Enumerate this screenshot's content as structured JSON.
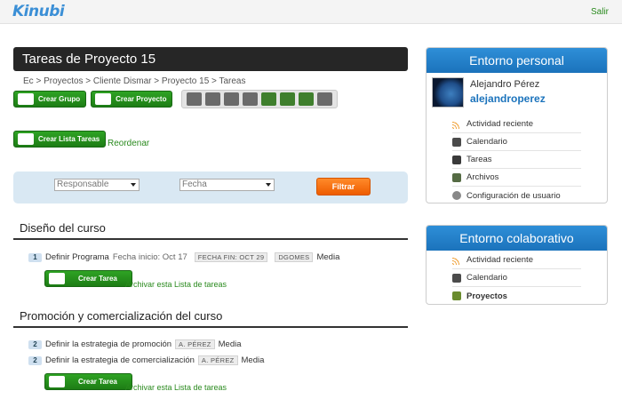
{
  "header": {
    "logo": "Kinubi",
    "logout": "Salir"
  },
  "page": {
    "title": "Tareas de Proyecto 15",
    "breadcrumb": "Ec > Proyectos > Cliente Dismar > Proyecto 15 > Tareas"
  },
  "toolbar": {
    "crear_grupo": "Crear Grupo",
    "crear_proyecto": "Crear Proyecto",
    "icons": [
      "calculator-icon",
      "calendar-icon",
      "chat-icon",
      "document-icon",
      "tasks-icon",
      "folder-icon",
      "users-icon",
      "settings-icon"
    ]
  },
  "actions": {
    "crear_lista": "Crear Lista Tareas",
    "reordenar": "Reordenar"
  },
  "filter": {
    "responsable": "Responsable",
    "fecha": "Fecha",
    "filtrar": "Filtrar"
  },
  "lists": [
    {
      "title": "Diseño del curso",
      "tasks": [
        {
          "num": "1",
          "name": "Definir Programa",
          "start": "Fecha inicio: Oct 17",
          "end": "FECHA FIN: OCT 29",
          "assignee": "DGOMES",
          "priority": "Media"
        }
      ],
      "crear_tarea": "Crear Tarea",
      "archivar": "Archivar esta Lista de tareas"
    },
    {
      "title": "Promoción y comercialización del curso",
      "tasks": [
        {
          "num": "2",
          "name": "Definir la estrategia de promoción",
          "assignee": "A. PÉREZ",
          "priority": "Media"
        },
        {
          "num": "2",
          "name": "Definir la estrategia de comercialización",
          "assignee": "A. PÉREZ",
          "priority": "Media"
        }
      ],
      "crear_tarea": "Crear Tarea",
      "archivar": "Archivar esta Lista de tareas"
    }
  ],
  "personal": {
    "title": "Entorno personal",
    "user_name": "Alejandro Pérez",
    "user_handle": "alejandroperez",
    "items": [
      {
        "label": "Actividad reciente",
        "icon": "rss-icon"
      },
      {
        "label": "Calendario",
        "icon": "calendar-icon"
      },
      {
        "label": "Tareas",
        "icon": "tasks-icon"
      },
      {
        "label": "Archivos",
        "icon": "files-icon"
      },
      {
        "label": "Configuración de usuario",
        "icon": "settings-icon"
      }
    ]
  },
  "colaborativo": {
    "title": "Entorno colaborativo",
    "items": [
      {
        "label": "Actividad reciente",
        "icon": "rss-icon"
      },
      {
        "label": "Calendario",
        "icon": "calendar-icon"
      },
      {
        "label": "Proyectos",
        "icon": "projects-icon",
        "active": true
      }
    ]
  },
  "colors": {
    "green": "#1d8a18",
    "blue": "#1b73bc",
    "orange": "#f26b0f",
    "title_bar": "#262626"
  }
}
